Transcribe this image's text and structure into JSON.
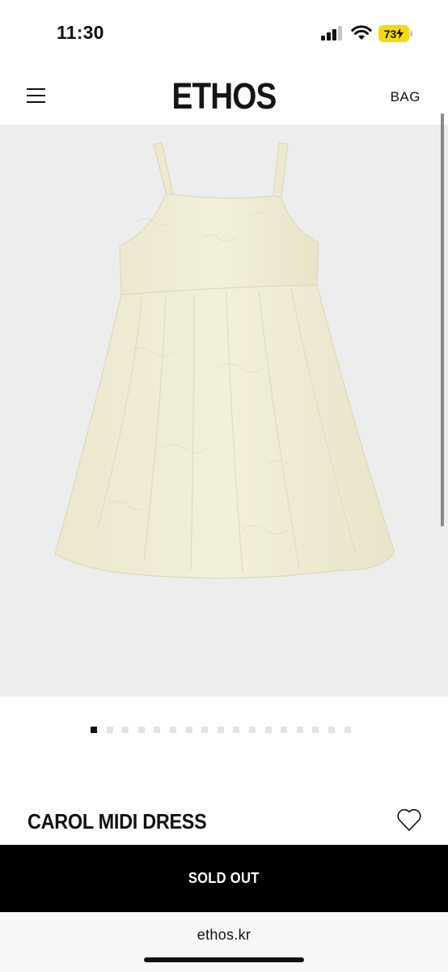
{
  "status_bar": {
    "time": "11:30",
    "battery_level": "73",
    "icons": [
      "cellular-signal-icon",
      "wifi-icon",
      "battery-charging-icon"
    ]
  },
  "header": {
    "menu_icon": "hamburger-menu-icon",
    "logo": "ETHOS",
    "bag_label": "BAG"
  },
  "product": {
    "image_description_icon": "dress-product-image",
    "carousel": {
      "total": 17,
      "active_index": 0
    },
    "name": "CAROL MIDI DRESS",
    "wishlist_icon": "heart-icon",
    "button_label": "SOLD OUT"
  },
  "browser": {
    "url": "ethos.kr"
  },
  "colors": {
    "image_background": "#ededed",
    "dress": "#f1eed6",
    "button_background": "#000000",
    "battery": "#f5d90a"
  }
}
